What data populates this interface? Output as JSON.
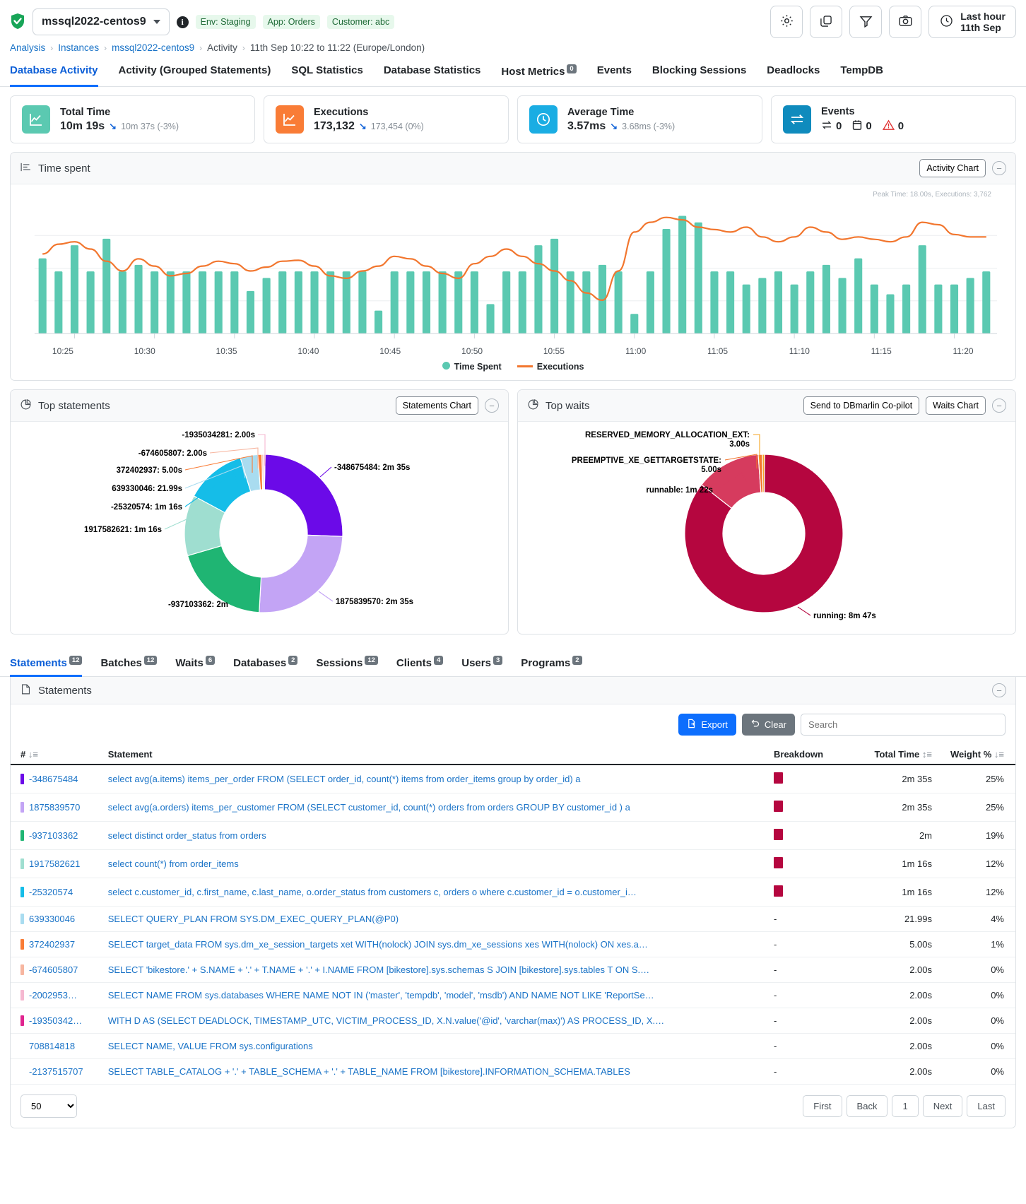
{
  "header": {
    "instance": "mssql2022-centos9",
    "tags": [
      "Env: Staging",
      "App: Orders",
      "Customer: abc"
    ],
    "time_label_1": "Last hour",
    "time_label_2": "11th Sep",
    "icons": [
      "gear-icon",
      "copy-icon",
      "filter-icon",
      "camera-icon",
      "clock-icon"
    ]
  },
  "breadcrumb": {
    "items": [
      "Analysis",
      "Instances",
      "mssql2022-centos9",
      "Activity"
    ],
    "range": "11th Sep 10:22 to 11:22 (Europe/London)"
  },
  "main_tabs": [
    {
      "label": "Database Activity",
      "badge": "",
      "active": true
    },
    {
      "label": "Activity (Grouped Statements)",
      "badge": "",
      "active": false
    },
    {
      "label": "SQL Statistics",
      "badge": "",
      "active": false
    },
    {
      "label": "Database Statistics",
      "badge": "",
      "active": false
    },
    {
      "label": "Host Metrics",
      "badge": "0",
      "active": false
    },
    {
      "label": "Events",
      "badge": "",
      "active": false
    },
    {
      "label": "Blocking Sessions",
      "badge": "",
      "active": false
    },
    {
      "label": "Deadlocks",
      "badge": "",
      "active": false
    },
    {
      "label": "TempDB",
      "badge": "",
      "active": false
    }
  ],
  "kpis": [
    {
      "title": "Total Time",
      "value": "10m 19s",
      "compare": "10m 37s (-3%)",
      "color": "#5bc9b1",
      "icon": "chart-line-icon"
    },
    {
      "title": "Executions",
      "value": "173,132",
      "compare": "173,454 (0%)",
      "color": "#f97c36",
      "icon": "chart-line-icon"
    },
    {
      "title": "Average Time",
      "value": "3.57ms",
      "compare": "3.68ms (-3%)",
      "color": "#1aade3",
      "icon": "clock-icon"
    },
    {
      "title": "Events",
      "value": "",
      "compare": "",
      "color": "#0f8bbd",
      "icon": "exchange-icon",
      "events": [
        {
          "icon": "exchange-icon",
          "count": "0"
        },
        {
          "icon": "calendar-icon",
          "count": "0"
        },
        {
          "icon": "warning-icon",
          "count": "0"
        }
      ]
    }
  ],
  "time_spent": {
    "title": "Time spent",
    "chart_select": "Activity Chart",
    "peak": "Peak Time: 18.00s, Executions: 3,762",
    "legend": [
      {
        "label": "Time Spent",
        "color": "#5bc9b1",
        "type": "bar"
      },
      {
        "label": "Executions",
        "color": "#f2762e",
        "type": "line"
      }
    ]
  },
  "top_statements": {
    "title": "Top statements",
    "chart_select": "Statements Chart",
    "labels_left": [
      "-1935034281: 2.00s",
      "-674605807: 2.00s",
      "372402937: 5.00s",
      "639330046: 21.99s",
      "-25320574: 1m 16s",
      "1917582621: 1m 16s",
      "-937103362: 2m"
    ],
    "labels_right": [
      "-348675484: 2m 35s",
      "1875839570: 2m 35s"
    ]
  },
  "top_waits": {
    "title": "Top waits",
    "copilot_btn": "Send to DBmarlin Co-pilot",
    "chart_select": "Waits Chart",
    "labels_left": [
      "RESERVED_MEMORY_ALLOCATION_EXT: 3.00s",
      "PREEMPTIVE_XE_GETTARGETSTATE: 5.00s",
      "runnable: 1m 22s"
    ],
    "labels_right": [
      "running: 8m 47s"
    ]
  },
  "sub_tabs": [
    {
      "label": "Statements",
      "badge": "12",
      "active": true
    },
    {
      "label": "Batches",
      "badge": "12",
      "active": false
    },
    {
      "label": "Waits",
      "badge": "6",
      "active": false
    },
    {
      "label": "Databases",
      "badge": "2",
      "active": false
    },
    {
      "label": "Sessions",
      "badge": "12",
      "active": false
    },
    {
      "label": "Clients",
      "badge": "4",
      "active": false
    },
    {
      "label": "Users",
      "badge": "3",
      "active": false
    },
    {
      "label": "Programs",
      "badge": "2",
      "active": false
    }
  ],
  "table_panel": {
    "title": "Statements",
    "export_label": "Export",
    "clear_label": "Clear",
    "search_placeholder": "Search",
    "columns": [
      "#",
      "Statement",
      "Breakdown",
      "Total Time",
      "Weight %"
    ],
    "rows": [
      {
        "id": "-348675484",
        "color": "#6b0ae8",
        "statement": "select avg(a.items) items_per_order FROM (SELECT order_id, count(*) items from order_items group by order_id) a",
        "breakdown": "bar",
        "total_time": "2m 35s",
        "weight": "25%"
      },
      {
        "id": "1875839570",
        "color": "#c3a4f5",
        "statement": "select avg(a.orders) items_per_customer FROM (SELECT customer_id, count(*) orders from orders GROUP BY customer_id ) a",
        "breakdown": "bar",
        "total_time": "2m 35s",
        "weight": "25%"
      },
      {
        "id": "-937103362",
        "color": "#1fb573",
        "statement": "select distinct order_status from orders",
        "breakdown": "bar",
        "total_time": "2m",
        "weight": "19%"
      },
      {
        "id": "1917582621",
        "color": "#9fded0",
        "statement": "select count(*) from order_items",
        "breakdown": "bar",
        "total_time": "1m 16s",
        "weight": "12%"
      },
      {
        "id": "-25320574",
        "color": "#15bde8",
        "statement": "select c.customer_id, c.first_name, c.last_name, o.order_status from customers c, orders o where c.customer_id = o.customer_i…",
        "breakdown": "bar",
        "total_time": "1m 16s",
        "weight": "12%"
      },
      {
        "id": "639330046",
        "color": "#a9dcf0",
        "statement": "SELECT QUERY_PLAN FROM SYS.DM_EXEC_QUERY_PLAN(@P0)",
        "breakdown": "-",
        "total_time": "21.99s",
        "weight": "4%"
      },
      {
        "id": "372402937",
        "color": "#f97c36",
        "statement": "SELECT target_data FROM sys.dm_xe_session_targets xet WITH(nolock) JOIN sys.dm_xe_sessions xes WITH(nolock) ON xes.a…",
        "breakdown": "-",
        "total_time": "5.00s",
        "weight": "1%"
      },
      {
        "id": "-674605807",
        "color": "#f7b6a0",
        "statement": "SELECT 'bikestore.' + S.NAME + '.' + T.NAME + '.' + I.NAME FROM [bikestore].sys.schemas S JOIN [bikestore].sys.tables T ON S.…",
        "breakdown": "-",
        "total_time": "2.00s",
        "weight": "0%"
      },
      {
        "id": "-2002953…",
        "color": "#f5b8d0",
        "statement": "SELECT NAME FROM sys.databases WHERE NAME NOT IN ('master', 'tempdb', 'model', 'msdb') AND NAME NOT LIKE 'ReportSe…",
        "breakdown": "-",
        "total_time": "2.00s",
        "weight": "0%"
      },
      {
        "id": "-19350342…",
        "color": "#e0258f",
        "statement": "WITH D AS (SELECT DEADLOCK, TIMESTAMP_UTC, VICTIM_PROCESS_ID, X.N.value('@id', 'varchar(max)') AS PROCESS_ID, X.…",
        "breakdown": "-",
        "total_time": "2.00s",
        "weight": "0%"
      },
      {
        "id": "708814818",
        "color": "",
        "statement": "SELECT NAME, VALUE FROM sys.configurations",
        "breakdown": "-",
        "total_time": "2.00s",
        "weight": "0%"
      },
      {
        "id": "-2137515707",
        "color": "",
        "statement": "SELECT TABLE_CATALOG + '.' + TABLE_SCHEMA + '.' + TABLE_NAME FROM [bikestore].INFORMATION_SCHEMA.TABLES",
        "breakdown": "-",
        "total_time": "2.00s",
        "weight": "0%"
      }
    ],
    "page_size": "50",
    "pager": [
      "First",
      "Back",
      "1",
      "Next",
      "Last"
    ]
  },
  "chart_data": [
    {
      "type": "bar",
      "title": "Time spent",
      "xlabel": "",
      "ylabel": "",
      "legend_position": "bottom",
      "grid": true,
      "tick_labels": [
        "10:25",
        "10:30",
        "10:35",
        "10:40",
        "10:45",
        "10:50",
        "10:55",
        "11:00",
        "11:05",
        "11:10",
        "11:15",
        "11:20"
      ],
      "series": [
        {
          "name": "Time Spent",
          "color": "#5bc9b1",
          "type": "bar",
          "values": [
            11.5,
            9.5,
            13.5,
            9.5,
            14.5,
            9.5,
            10.5,
            9.5,
            9.5,
            9.5,
            9.5,
            9.5,
            9.5,
            6.5,
            8.5,
            9.5,
            9.5,
            9.5,
            9.5,
            9.5,
            9.5,
            3.5,
            9.5,
            9.5,
            9.5,
            9.5,
            9.5,
            9.5,
            4.5,
            9.5,
            9.5,
            13.5,
            14.5,
            9.5,
            9.5,
            10.5,
            9.5,
            3.0,
            9.5,
            16.0,
            18.0,
            17.0,
            9.5,
            9.5,
            7.5,
            8.5,
            9.5,
            7.5,
            9.5,
            10.5,
            8.5,
            11.5,
            7.5,
            6.0,
            7.5,
            13.5,
            7.5,
            7.5,
            8.5,
            9.5
          ]
        },
        {
          "name": "Executions",
          "color": "#f2762e",
          "type": "line",
          "values": [
            2950,
            3150,
            3200,
            3050,
            2800,
            2600,
            2850,
            2700,
            2500,
            2550,
            2700,
            2800,
            2750,
            2600,
            2680,
            2800,
            2820,
            2700,
            2500,
            2450,
            2600,
            2700,
            2900,
            2850,
            2700,
            2550,
            2450,
            2750,
            2900,
            3050,
            2900,
            2750,
            2600,
            2400,
            2150,
            2000,
            2600,
            3400,
            3600,
            3700,
            3650,
            3500,
            3450,
            3400,
            3500,
            3300,
            3200,
            3300,
            3500,
            3400,
            3250,
            3300,
            3250,
            3200,
            3300,
            3600,
            3550,
            3350,
            3300,
            3300
          ]
        }
      ]
    },
    {
      "type": "pie",
      "title": "Top statements",
      "labels": [
        "-348675484",
        "1875839570",
        "-937103362",
        "1917582621",
        "-25320574",
        "639330046",
        "372402937",
        "-674605807",
        "-1935034281"
      ],
      "values": [
        155,
        155,
        120,
        76,
        76,
        21.99,
        5,
        2,
        2
      ],
      "value_labels": [
        "2m 35s",
        "2m 35s",
        "2m",
        "1m 16s",
        "1m 16s",
        "21.99s",
        "5.00s",
        "2.00s",
        "2.00s"
      ],
      "colors": [
        "#6b0ae8",
        "#c3a4f5",
        "#1fb573",
        "#9fded0",
        "#15bde8",
        "#a9dcf0",
        "#f97c36",
        "#f7b6a0",
        "#f5b8d0"
      ]
    },
    {
      "type": "pie",
      "title": "Top waits",
      "labels": [
        "running",
        "runnable",
        "PREEMPTIVE_XE_GETTARGETSTATE",
        "RESERVED_MEMORY_ALLOCATION_EXT"
      ],
      "values": [
        527,
        82,
        5,
        3
      ],
      "value_labels": [
        "8m 47s",
        "1m 22s",
        "5.00s",
        "3.00s"
      ],
      "colors": [
        "#b5063f",
        "#d63b5e",
        "#f2762e",
        "#f5a623"
      ]
    }
  ]
}
